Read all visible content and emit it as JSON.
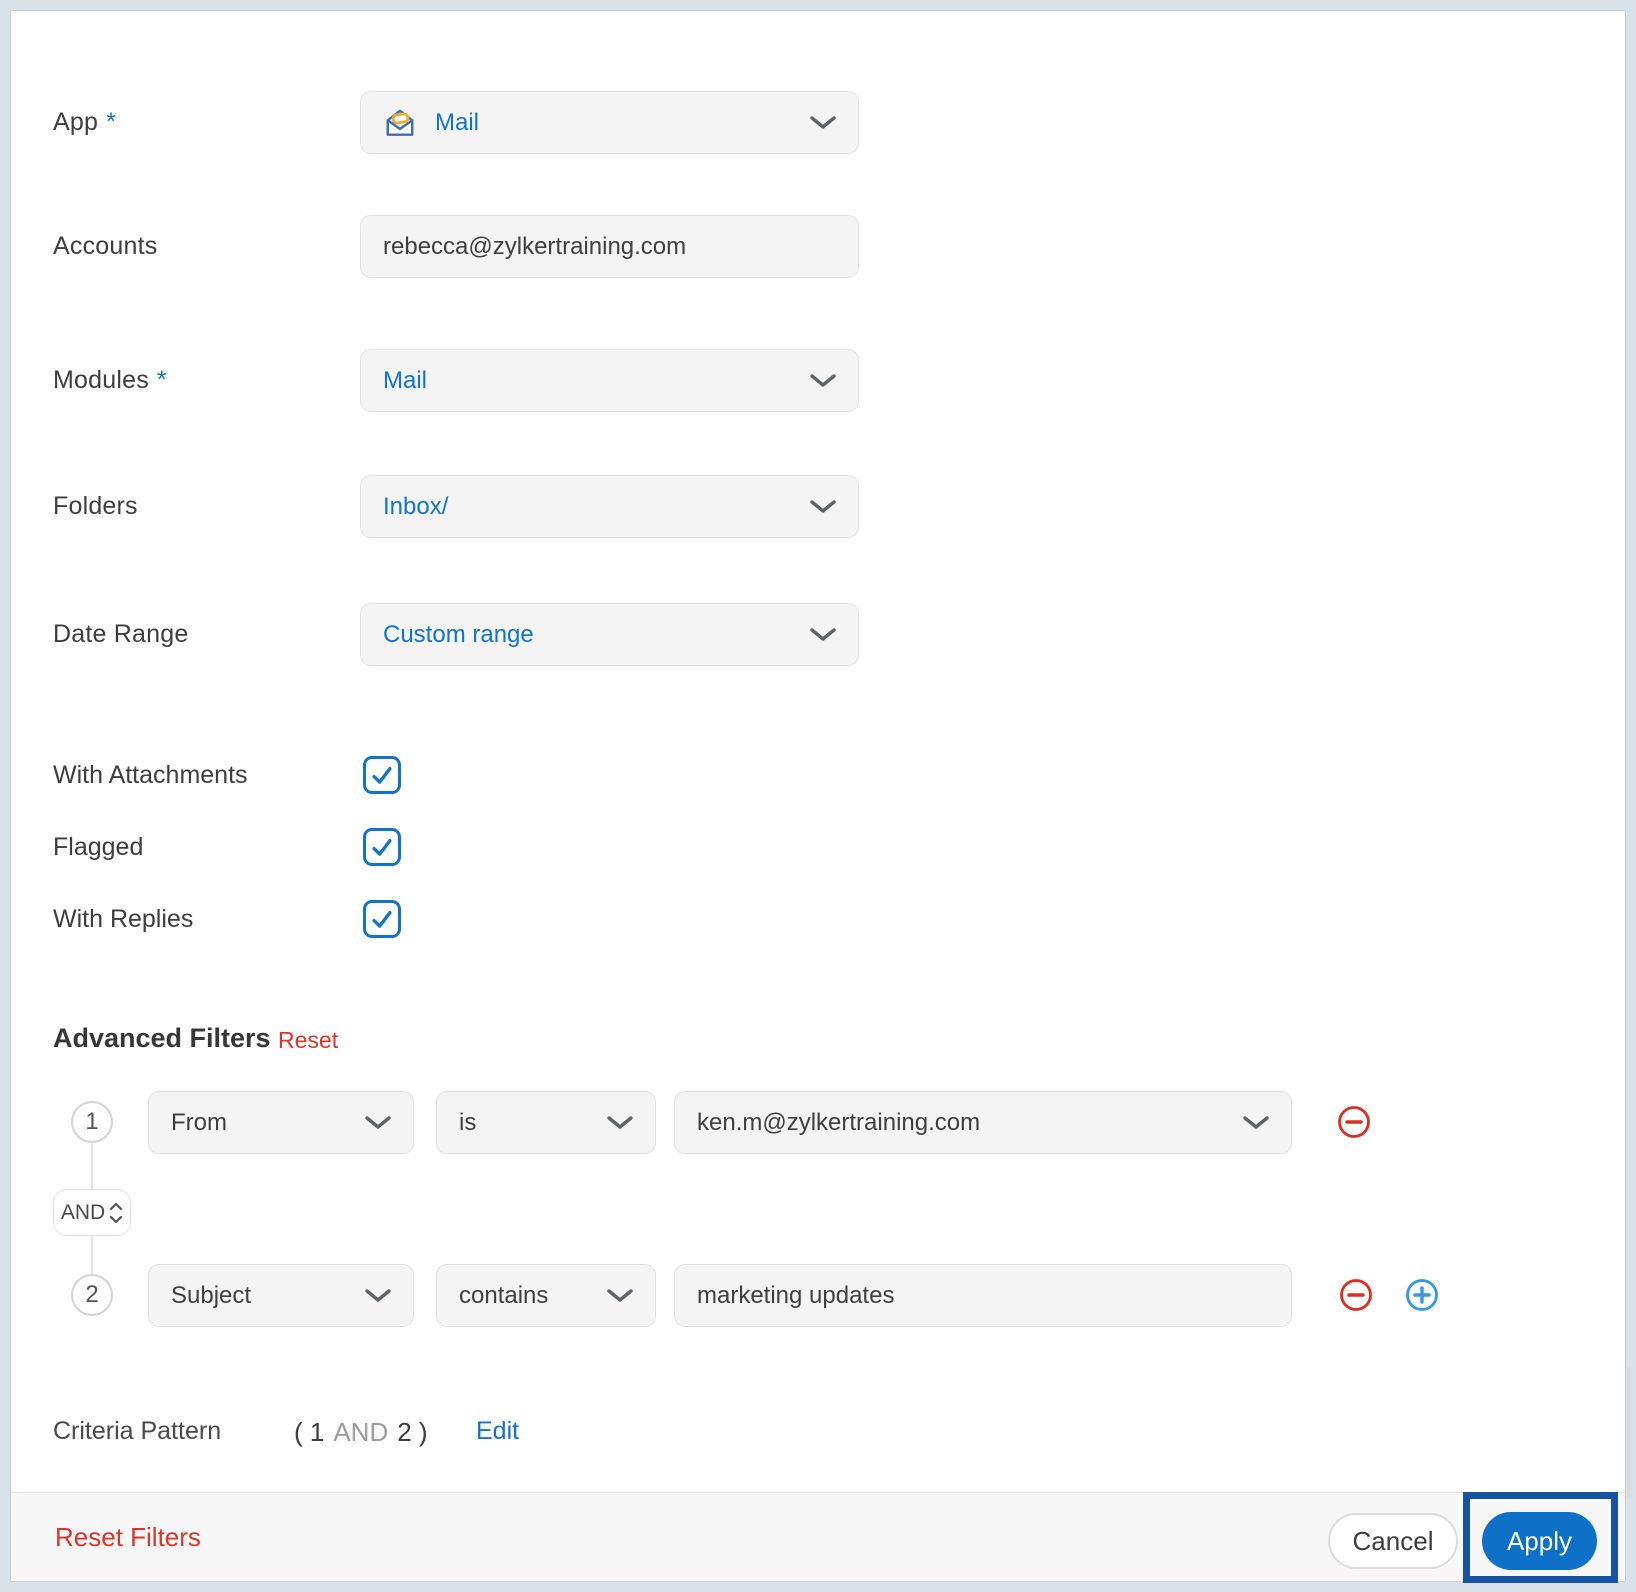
{
  "header_fields": {
    "app": {
      "label": "App",
      "required": "*",
      "value": "Mail"
    },
    "accounts": {
      "label": "Accounts",
      "value": "rebecca@zylkertraining.com"
    },
    "modules": {
      "label": "Modules",
      "required": "*",
      "value": "Mail"
    },
    "folders": {
      "label": "Folders",
      "value": "Inbox/"
    },
    "date_range": {
      "label": "Date Range",
      "value": "Custom range"
    }
  },
  "checkboxes": {
    "with_attachments": {
      "label": "With Attachments",
      "checked": true
    },
    "flagged": {
      "label": "Flagged",
      "checked": true
    },
    "with_replies": {
      "label": "With Replies",
      "checked": true
    }
  },
  "advanced_filters": {
    "title": "Advanced Filters",
    "reset_label": "Reset",
    "connector": "AND",
    "rows": [
      {
        "number": "1",
        "field": "From",
        "operator": "is",
        "value": "ken.m@zylkertraining.com"
      },
      {
        "number": "2",
        "field": "Subject",
        "operator": "contains",
        "value": "marketing updates"
      }
    ],
    "criteria_pattern": {
      "label": "Criteria Pattern",
      "pattern_open": "( 1",
      "pattern_operator": "AND",
      "pattern_close": "2 )",
      "edit_label": "Edit"
    }
  },
  "footer": {
    "reset_filters_label": "Reset Filters",
    "cancel_label": "Cancel",
    "apply_label": "Apply"
  },
  "colors": {
    "accent_blue": "#1273cc",
    "danger_red": "#d8362a",
    "plus_blue": "#3698e0",
    "apply_button_blue": "#0f70c8",
    "apply_highlight_navy": "#1553a5",
    "frame": "#d9e2e8"
  }
}
